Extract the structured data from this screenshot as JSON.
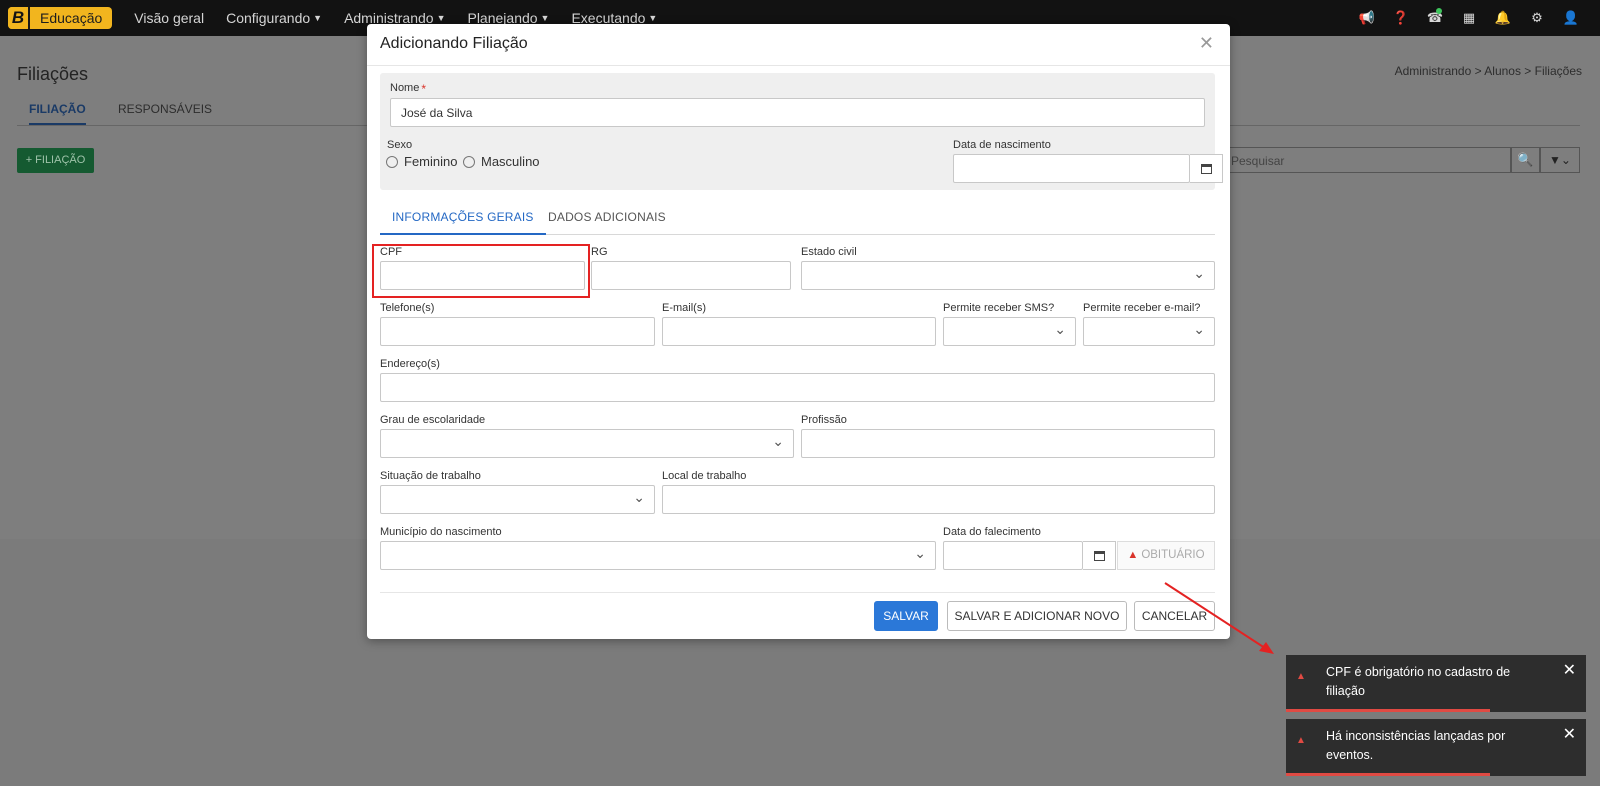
{
  "nav": {
    "brand_letter": "B",
    "brand_name": "Educação",
    "items": [
      {
        "label": "Visão geral",
        "has_dropdown": false
      },
      {
        "label": "Configurando",
        "has_dropdown": true
      },
      {
        "label": "Administrando",
        "has_dropdown": true
      },
      {
        "label": "Planejando",
        "has_dropdown": true
      },
      {
        "label": "Executando",
        "has_dropdown": true
      }
    ],
    "icons": [
      "megaphone-icon",
      "help-icon",
      "support-icon",
      "apps-grid-icon",
      "bell-icon",
      "settings-icon",
      "user-icon"
    ]
  },
  "page": {
    "title": "Filiações",
    "breadcrumb": "Administrando > Alunos > Filiações",
    "tabs": [
      {
        "label": "FILIAÇÃO",
        "active": true
      },
      {
        "label": "RESPONSÁVEIS",
        "active": false
      }
    ],
    "add_button": "+ FILIAÇÃO",
    "search_placeholder": "Pesquisar"
  },
  "modal": {
    "title": "Adicionando Filiação",
    "nome": {
      "label": "Nome",
      "value": "José da Silva"
    },
    "sexo": {
      "label": "Sexo",
      "options": [
        "Feminino",
        "Masculino"
      ]
    },
    "nascimento": {
      "label": "Data de nascimento",
      "value": ""
    },
    "tabs": [
      {
        "label": "INFORMAÇÕES GERAIS",
        "active": true
      },
      {
        "label": "DADOS ADICIONAIS",
        "active": false
      }
    ],
    "fields": {
      "cpf": "CPF",
      "rg": "RG",
      "estado_civil": "Estado civil",
      "telefones": "Telefone(s)",
      "emails": "E-mail(s)",
      "permite_sms": "Permite receber SMS?",
      "permite_email": "Permite receber e-mail?",
      "enderecos": "Endereço(s)",
      "grau_escolaridade": "Grau de escolaridade",
      "profissao": "Profissão",
      "situacao_trabalho": "Situação de trabalho",
      "local_trabalho": "Local de trabalho",
      "municipio_nascimento": "Município do nascimento",
      "data_falecimento": "Data do falecimento"
    },
    "obituario_button": "OBITUÁRIO",
    "buttons": {
      "save": "SALVAR",
      "save_and_new": "SALVAR E ADICIONAR NOVO",
      "cancel": "CANCELAR"
    }
  },
  "toasts": [
    {
      "message": "CPF é obrigatório no cadastro de filiação",
      "progress": 0.68
    },
    {
      "message": "Há inconsistências lançadas por eventos.",
      "progress": 0.68
    }
  ],
  "colors": {
    "brand": "#f2b51e",
    "primary": "#2b78d8",
    "error": "#e04a43",
    "highlight": "#e42222"
  }
}
